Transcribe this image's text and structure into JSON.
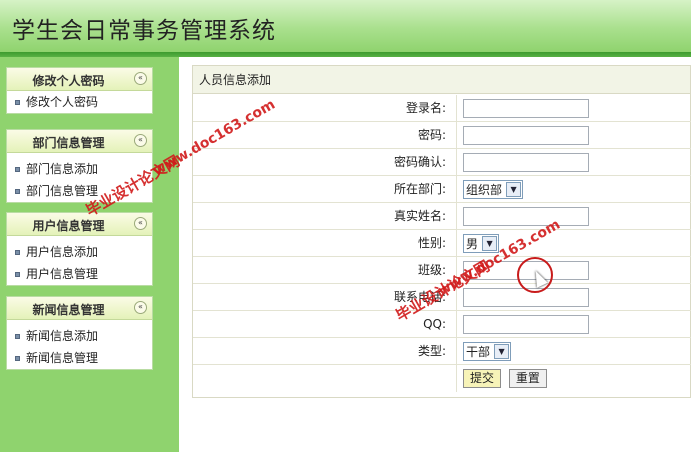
{
  "header": {
    "title": "学生会日常事务管理系统"
  },
  "sidebar": {
    "panels": [
      {
        "title": "修改个人密码",
        "items": [
          "修改个人密码"
        ]
      },
      {
        "title": "部门信息管理",
        "items": [
          "部门信息添加",
          "部门信息管理"
        ]
      },
      {
        "title": "用户信息管理",
        "items": [
          "用户信息添加",
          "用户信息管理"
        ]
      },
      {
        "title": "新闻信息管理",
        "items": [
          "新闻信息添加",
          "新闻信息管理"
        ]
      }
    ],
    "collapse_glyph": "«"
  },
  "form": {
    "title": "人员信息添加",
    "fields": {
      "login": {
        "label": "登录名:",
        "value": ""
      },
      "password": {
        "label": "密码:",
        "value": ""
      },
      "password_confirm": {
        "label": "密码确认:",
        "value": ""
      },
      "department": {
        "label": "所在部门:",
        "selected": "组织部"
      },
      "realname": {
        "label": "真实姓名:",
        "value": ""
      },
      "gender": {
        "label": "性别:",
        "selected": "男"
      },
      "class": {
        "label": "班级:",
        "value": ""
      },
      "phone": {
        "label": "联系电话:",
        "value": ""
      },
      "qq": {
        "label": "QQ:",
        "value": ""
      },
      "type": {
        "label": "类型:",
        "selected": "干部"
      }
    },
    "submit_label": "提交",
    "reset_label": "重置"
  },
  "watermark": {
    "url": "www.doc163.com",
    "site": "毕业设计论文网"
  },
  "colors": {
    "sidebar_bg": "#8fd36e",
    "header_bar": "#3c9b2e",
    "watermark": "#d11a1a"
  }
}
